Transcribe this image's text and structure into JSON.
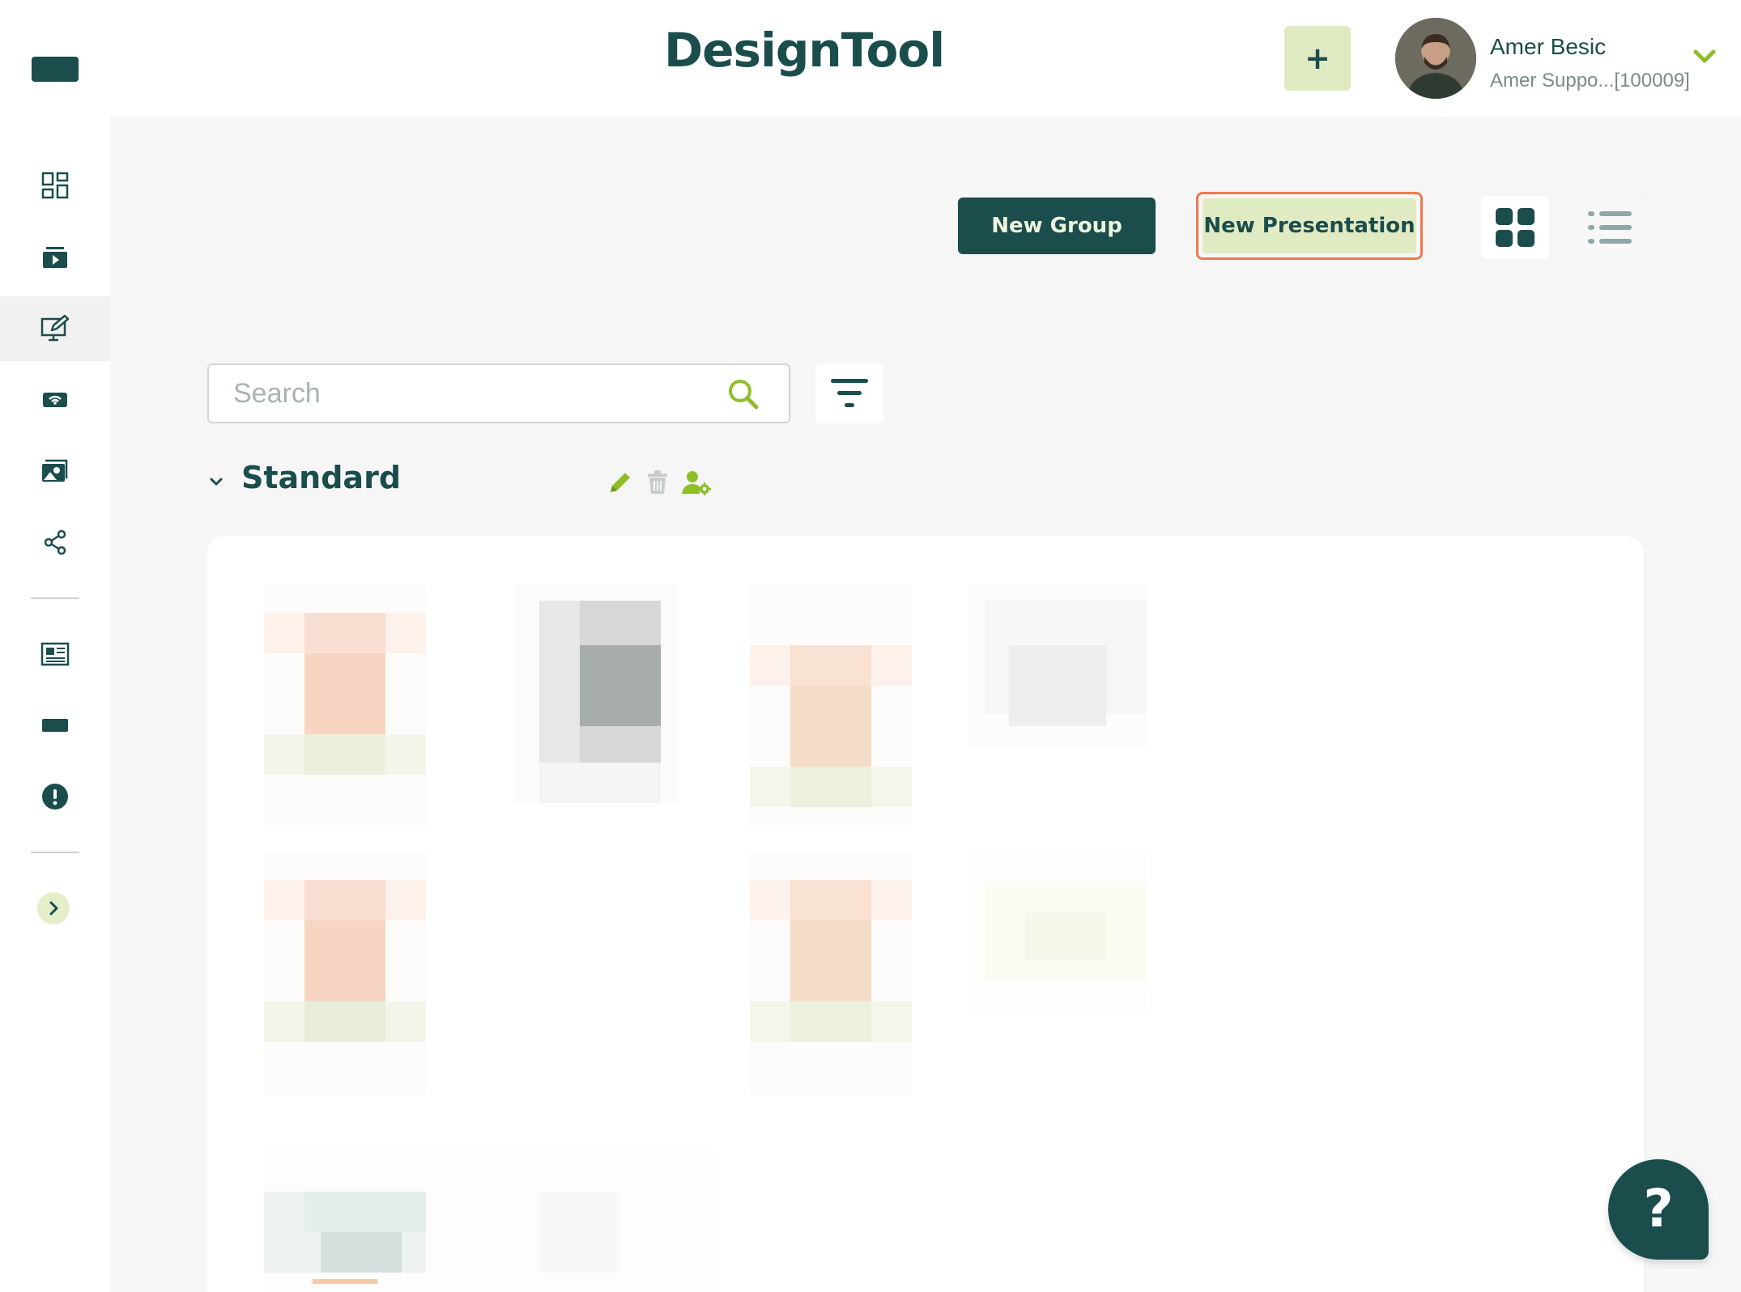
{
  "app": {
    "logo_text": "DesignTool",
    "accent_color": "#1a4d4c",
    "highlight_color": "#ee7a4e"
  },
  "header": {
    "add_label": "+",
    "user": {
      "name": "Amer Besic",
      "subtitle": "Amer Suppo...[100009]"
    }
  },
  "sidebar": {
    "items": [
      {
        "icon": "dashboard-icon"
      },
      {
        "icon": "media-player-icon"
      },
      {
        "icon": "presentation-edit-icon",
        "active": true
      },
      {
        "icon": "signal-icon"
      },
      {
        "icon": "gallery-icon"
      },
      {
        "icon": "share-icon"
      },
      {
        "icon": "news-icon"
      },
      {
        "icon": "screen-icon"
      },
      {
        "icon": "alert-icon"
      }
    ],
    "expand_icon": "chevron-right-icon"
  },
  "toolbar": {
    "new_group_label": "New Group",
    "new_presentation_label": "New Presentation"
  },
  "search": {
    "placeholder": "Search",
    "value": ""
  },
  "group": {
    "title": "Standard"
  },
  "help": {
    "label": "?"
  }
}
